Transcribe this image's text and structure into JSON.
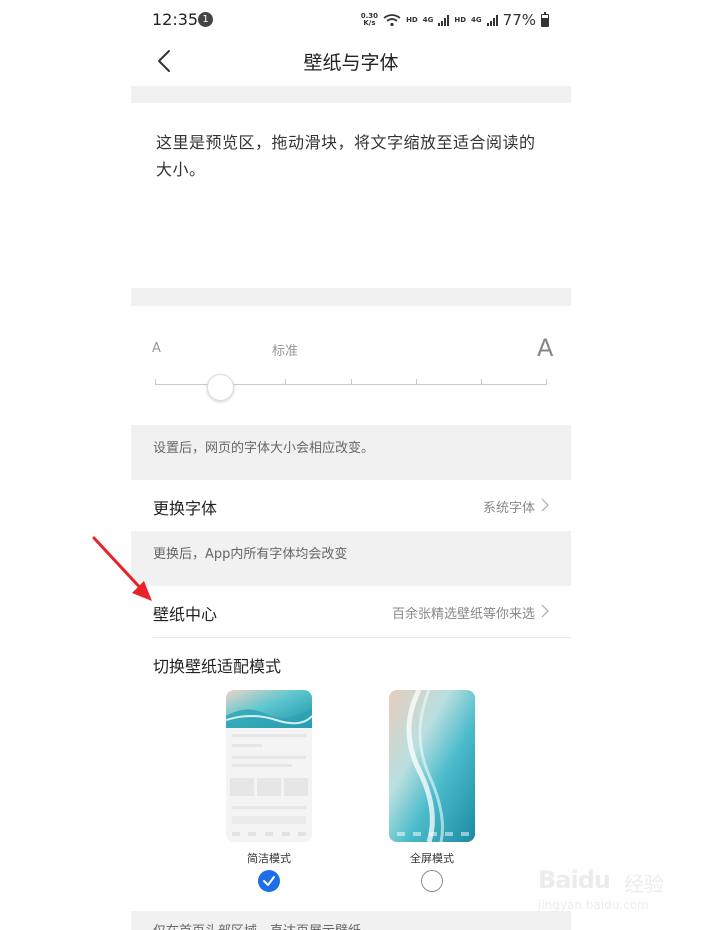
{
  "status_bar": {
    "time": "12:35",
    "notification_count": "1",
    "net_speed_value": "0.30",
    "net_speed_unit": "K/s",
    "hd1": "HD",
    "net1": "4G",
    "hd2": "HD",
    "net2": "4G",
    "battery": "77%"
  },
  "header": {
    "title": "壁纸与字体"
  },
  "preview": {
    "text": "这里是预览区，拖动滑块，将文字缩放至适合阅读的大小。"
  },
  "font_size": {
    "small_label": "A",
    "current_label": "标准",
    "large_label": "A",
    "level_index": 1,
    "level_count": 7,
    "note": "设置后，网页的字体大小会相应改变。"
  },
  "change_font": {
    "label": "更换字体",
    "value": "系统字体",
    "note": "更换后，App内所有字体均会改变"
  },
  "wallpaper": {
    "label": "壁纸中心",
    "value": "百余张精选壁纸等你来选",
    "mode_title": "切换壁纸适配模式",
    "modes": [
      {
        "label": "简洁模式",
        "selected": true
      },
      {
        "label": "全屏模式",
        "selected": false
      }
    ],
    "bottom_note": "仅在首页头部区域，直达页展示壁纸"
  },
  "watermark": {
    "brand": "Bai",
    "brand2": "du",
    "suffix": "经验",
    "url": "jingyan.baidu.com"
  },
  "colors": {
    "accent": "#1e6ee8",
    "arrow": "#e8232a",
    "background": "#f1f1f1"
  }
}
